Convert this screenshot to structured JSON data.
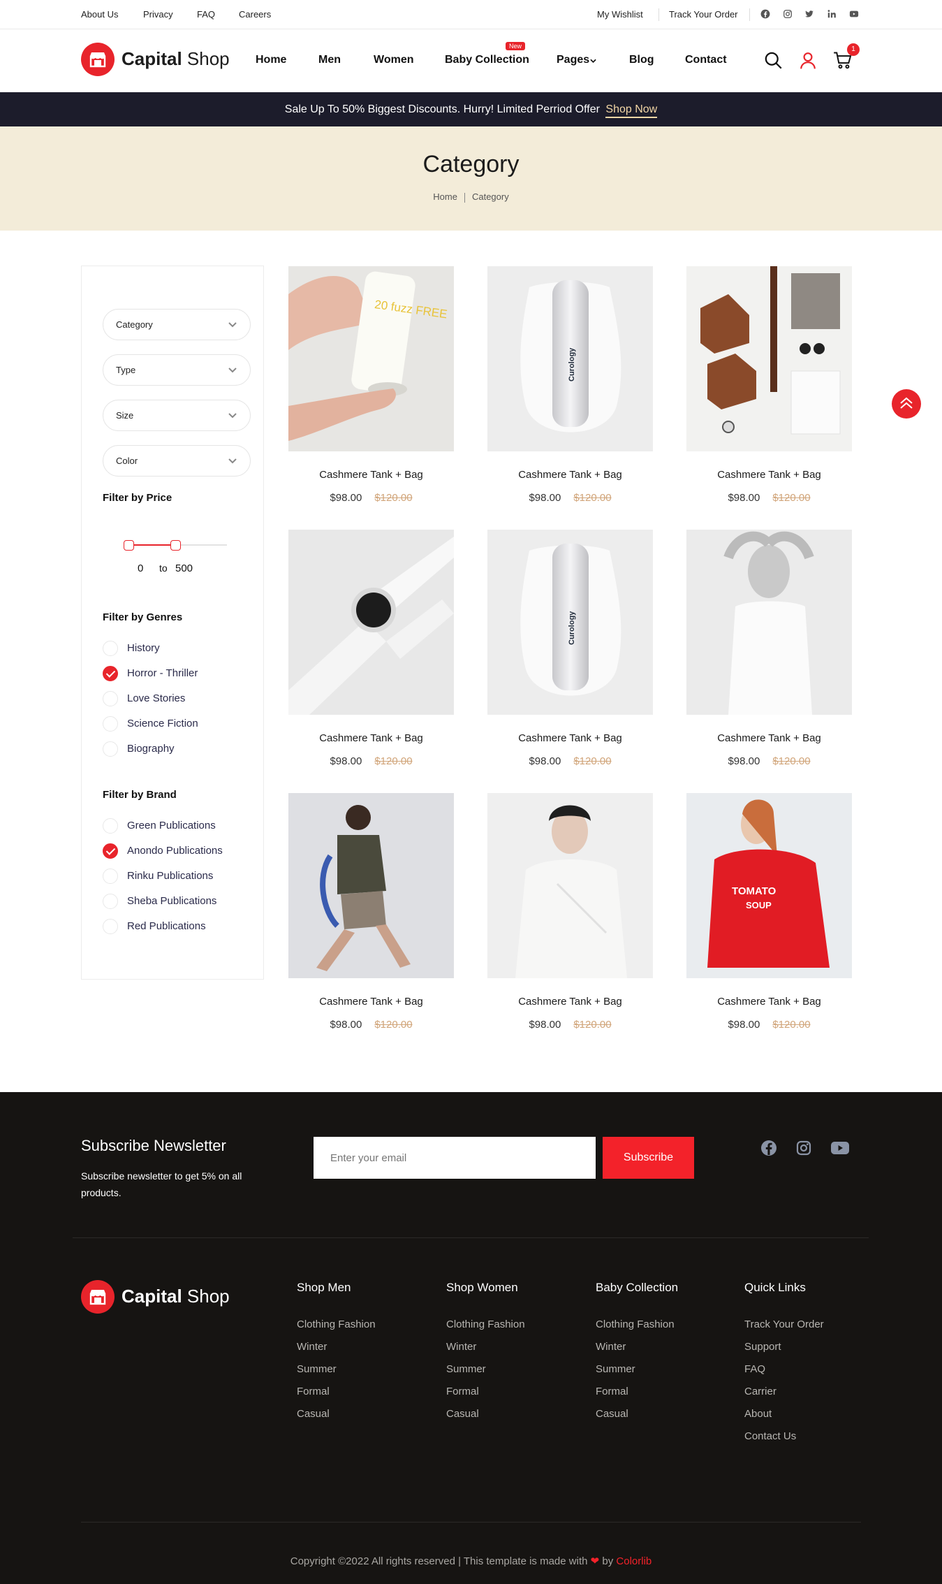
{
  "topbar": {
    "links": [
      "About Us",
      "Privacy",
      "FAQ",
      "Careers"
    ],
    "wishlist": "My Wishlist",
    "track": "Track Your Order",
    "social": [
      "facebook-icon",
      "instagram-icon",
      "twitter-icon",
      "linkedin-icon",
      "youtube-icon"
    ]
  },
  "header": {
    "logo_bold": "Capital",
    "logo_light": "Shop",
    "nav": [
      "Home",
      "Men",
      "Women",
      "Baby Collection",
      "Pages",
      "Blog",
      "Contact"
    ],
    "new_badge": "New",
    "cart_count": "1"
  },
  "promo": {
    "text": "Sale Up To 50% Biggest Discounts. Hurry! Limited Perriod Offer",
    "link": "Shop Now"
  },
  "hero": {
    "title": "Category",
    "breadcrumb": [
      "Home",
      "Category"
    ]
  },
  "sidebar": {
    "selects": [
      "Category",
      "Type",
      "Size",
      "Color"
    ],
    "price_title": "Filter by Price",
    "price_min": "0",
    "price_to": "to",
    "price_max": "500",
    "genres_title": "Filter by Genres",
    "genres": [
      {
        "label": "History",
        "checked": false
      },
      {
        "label": "Horror - Thriller",
        "checked": true
      },
      {
        "label": "Love Stories",
        "checked": false
      },
      {
        "label": "Science Fiction",
        "checked": false
      },
      {
        "label": "Biography",
        "checked": false
      }
    ],
    "brand_title": "Filter by Brand",
    "brands": [
      {
        "label": "Green Publications",
        "checked": false
      },
      {
        "label": "Anondo Publications",
        "checked": true
      },
      {
        "label": "Rinku Publications",
        "checked": false
      },
      {
        "label": "Sheba Publications",
        "checked": false
      },
      {
        "label": "Red Publications",
        "checked": false
      }
    ]
  },
  "products": [
    {
      "name": "Cashmere Tank + Bag",
      "price": "$98.00",
      "old_price": "$120.00",
      "image": "lotion-tube",
      "print": "20 fuzz FREE"
    },
    {
      "name": "Cashmere Tank + Bag",
      "price": "$98.00",
      "old_price": "$120.00",
      "image": "curology-bottle",
      "print": "Curology"
    },
    {
      "name": "Cashmere Tank + Bag",
      "price": "$98.00",
      "old_price": "$120.00",
      "image": "flatlay-boots"
    },
    {
      "name": "Cashmere Tank + Bag",
      "price": "$98.00",
      "old_price": "$120.00",
      "image": "smartwatch"
    },
    {
      "name": "Cashmere Tank + Bag",
      "price": "$98.00",
      "old_price": "$120.00",
      "image": "curology-bottle",
      "print": "Curology"
    },
    {
      "name": "Cashmere Tank + Bag",
      "price": "$98.00",
      "old_price": "$120.00",
      "image": "woman-white-top"
    },
    {
      "name": "Cashmere Tank + Bag",
      "price": "$98.00",
      "old_price": "$120.00",
      "image": "man-running"
    },
    {
      "name": "Cashmere Tank + Bag",
      "price": "$98.00",
      "old_price": "$120.00",
      "image": "woman-white-shirt"
    },
    {
      "name": "Cashmere Tank + Bag",
      "price": "$98.00",
      "old_price": "$120.00",
      "image": "woman-red-sweater",
      "print": "TOMATO SOUP"
    }
  ],
  "newsletter": {
    "title": "Subscribe Newsletter",
    "text": "Subscribe newsletter to get 5% on all products.",
    "placeholder": "Enter your email",
    "button": "Subscribe",
    "social": [
      "facebook-icon",
      "instagram-icon",
      "youtube-icon"
    ]
  },
  "footer": {
    "logo_bold": "Capital",
    "logo_light": "Shop",
    "columns": [
      {
        "title": "Shop Men",
        "links": [
          "Clothing Fashion",
          "Winter",
          "Summer",
          "Formal",
          "Casual"
        ]
      },
      {
        "title": "Shop Women",
        "links": [
          "Clothing Fashion",
          "Winter",
          "Summer",
          "Formal",
          "Casual"
        ]
      },
      {
        "title": "Baby Collection",
        "links": [
          "Clothing Fashion",
          "Winter",
          "Summer",
          "Formal",
          "Casual"
        ]
      },
      {
        "title": "Quick Links",
        "links": [
          "Track Your Order",
          "Support",
          "FAQ",
          "Carrier",
          "About",
          "Contact Us"
        ]
      }
    ],
    "copyright_pre": "Copyright ©2022 All rights reserved | This template is made with",
    "copyright_by": "by",
    "copyright_brand": "Colorlib"
  },
  "colors": {
    "accent": "#e8242b",
    "promo_bg": "#1c1c2b",
    "hero_bg": "#f3ecd9",
    "footer_bg": "#161412",
    "old_price": "#d1a57a"
  }
}
